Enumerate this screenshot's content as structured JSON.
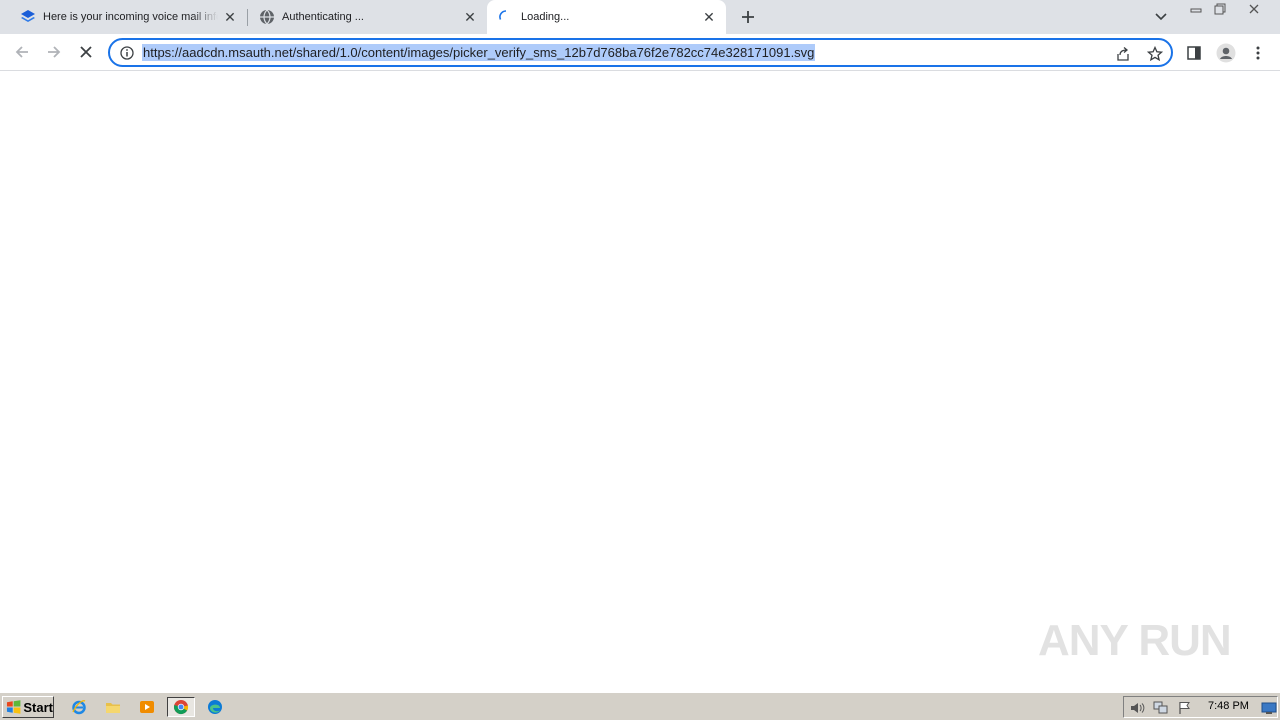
{
  "browser": {
    "tabs": [
      {
        "title": "Here is your incoming voice mail info",
        "favicon": "layers-icon",
        "active": false
      },
      {
        "title": "Authenticating ...",
        "favicon": "globe-icon",
        "active": false
      },
      {
        "title": "Loading...",
        "favicon": "loading-spinner-icon",
        "active": true
      }
    ],
    "url": "https://aadcdn.msauth.net/shared/1.0/content/images/picker_verify_sms_12b7d768ba76f2e782cc74e328171091.svg",
    "accent_color": "#1a73e8",
    "selection_color": "#aecbfa"
  },
  "watermark": {
    "text": "ANY RUN"
  },
  "taskbar": {
    "start_label": "Start",
    "clock": "7:48 PM",
    "quick_launch": [
      "internet-explorer-icon",
      "file-explorer-icon",
      "media-player-icon",
      "chrome-icon",
      "edge-icon"
    ]
  }
}
